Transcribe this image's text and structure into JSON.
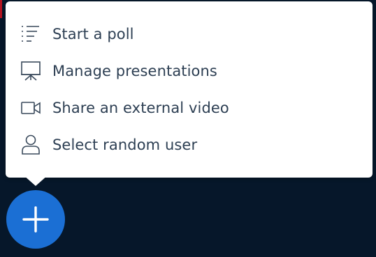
{
  "menu": {
    "items": [
      {
        "label": "Start a poll",
        "icon": "list-icon"
      },
      {
        "label": "Manage presentations",
        "icon": "presentation-icon"
      },
      {
        "label": "Share an external video",
        "icon": "video-camera-icon"
      },
      {
        "label": "Select random user",
        "icon": "user-icon"
      }
    ]
  },
  "fab": {
    "icon": "plus-icon"
  },
  "colors": {
    "background": "#06172a",
    "menu_background": "#ffffff",
    "text": "#2d3f53",
    "accent": "#1b6fd4"
  }
}
